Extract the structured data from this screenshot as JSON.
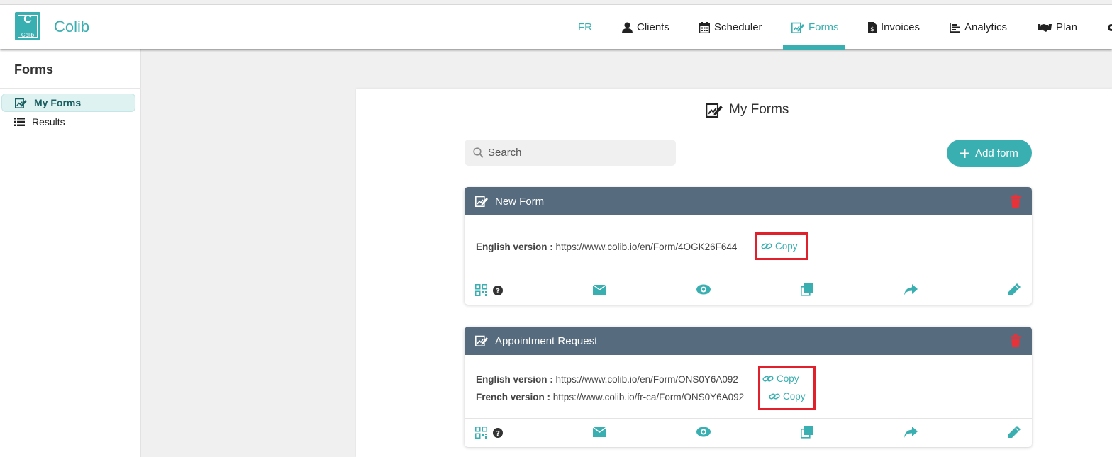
{
  "app": {
    "brand": "Colib",
    "logo_label": "Colib",
    "logo_letter": "C",
    "accent": "#3aafb1"
  },
  "nav": {
    "lang": "FR",
    "items": [
      {
        "label": "Clients",
        "icon": "user-icon"
      },
      {
        "label": "Scheduler",
        "icon": "calendar-icon"
      },
      {
        "label": "Forms",
        "icon": "form-edit-icon",
        "active": true
      },
      {
        "label": "Invoices",
        "icon": "invoice-icon"
      },
      {
        "label": "Analytics",
        "icon": "chart-icon"
      },
      {
        "label": "Plan",
        "icon": "handshake-icon"
      }
    ]
  },
  "sidebar": {
    "title": "Forms",
    "items": [
      {
        "label": "My Forms",
        "active": true,
        "icon": "form-edit-icon"
      },
      {
        "label": "Results",
        "icon": "list-icon"
      }
    ]
  },
  "main": {
    "title": "My Forms",
    "search_placeholder": "Search",
    "add_button": "Add form"
  },
  "forms": [
    {
      "title": "New Form",
      "links": [
        {
          "label": "English version :",
          "url": "https://www.colib.io/en/Form/4OGK26F644",
          "copy": "Copy"
        }
      ]
    },
    {
      "title": "Appointment Request",
      "links": [
        {
          "label": "English version :",
          "url": "https://www.colib.io/en/Form/ONS0Y6A092",
          "copy": "Copy"
        },
        {
          "label": "French version :",
          "url": "https://www.colib.io/fr-ca/Form/ONS0Y6A092",
          "copy": "Copy"
        }
      ]
    }
  ],
  "footer_icons": [
    "qr-code-icon",
    "help-icon",
    "envelope-icon",
    "eye-icon",
    "duplicate-icon",
    "share-icon",
    "pencil-icon"
  ]
}
